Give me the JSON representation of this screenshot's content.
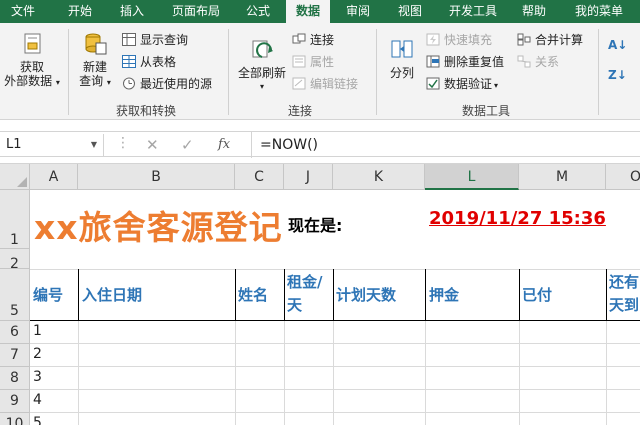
{
  "ribbon_tabs": [
    "文件",
    "开始",
    "插入",
    "页面布局",
    "公式",
    "数据",
    "审阅",
    "视图",
    "开发工具",
    "帮助",
    "我的菜单"
  ],
  "active_tab": "数据",
  "groups": {
    "get_transform": {
      "label": "获取和转换",
      "get_external_line1": "获取",
      "get_external_line2": "外部数据",
      "new_query_line1": "新建",
      "new_query_line2": "查询",
      "show_queries": "显示查询",
      "from_table": "从表格",
      "recent_sources": "最近使用的源"
    },
    "connections": {
      "label": "连接",
      "refresh_all": "全部刷新",
      "connections": "连接",
      "properties": "属性",
      "edit_links": "编辑链接"
    },
    "data_tools": {
      "label": "数据工具",
      "split": "分列",
      "flash_fill": "快速填充",
      "remove_duplicates": "删除重复值",
      "data_validation": "数据验证",
      "consolidate": "合并计算",
      "relationships": "关系"
    },
    "sort": {
      "az": "A↓",
      "za": "Z↓"
    }
  },
  "formula_bar": {
    "name_box": "L1",
    "formula": "=NOW()",
    "fx": "fx",
    "cancel": "✕",
    "enter": "✓"
  },
  "columns": [
    "A",
    "B",
    "C",
    "J",
    "K",
    "L",
    "M",
    "O"
  ],
  "selected_column": "L",
  "rows": [
    "1",
    "2",
    "5",
    "6",
    "7",
    "8",
    "9",
    "10"
  ],
  "sheet": {
    "title": "xx旅舍客源登记",
    "now_label": "现在是:",
    "now_value": "2019/11/27 15:36",
    "headers": {
      "id": "编号",
      "checkin_date": "入住日期",
      "name": "姓名",
      "rent_line1": "租金/",
      "rent_line2": "天",
      "planned_days": "计划天数",
      "deposit": "押金",
      "paid": "已付",
      "remaining_line1": "还有",
      "remaining_line2": "天到"
    },
    "ids": [
      "1",
      "2",
      "3",
      "4",
      "5"
    ]
  },
  "colors": {
    "excel_green": "#217346",
    "title_orange": "#ed7d31",
    "header_blue": "#2e75b6",
    "time_red": "#e00000"
  }
}
